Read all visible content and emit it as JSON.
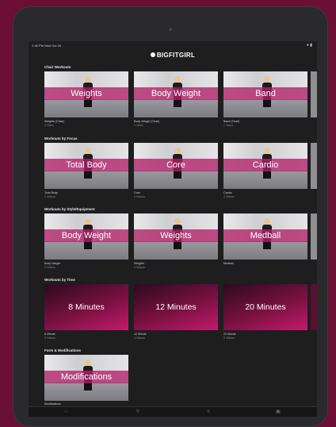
{
  "status_bar": {
    "time": "2:38 PM  Wed Oct 26",
    "indicators": "● ▮"
  },
  "app": {
    "logo": "BIGFITGIRL"
  },
  "sections": [
    {
      "title": "Chair Workouts",
      "cards": [
        {
          "label": "Weights",
          "caption": "Weights (Chair)",
          "sub": "1 Video"
        },
        {
          "label": "Body Weight",
          "caption": "Body Weight (Chair)",
          "sub": "1 Video"
        },
        {
          "label": "Band",
          "caption": "Band (Chair)",
          "sub": "1 Video"
        }
      ]
    },
    {
      "title": "Workouts by Focus",
      "cards": [
        {
          "label": "Total Body",
          "caption": "Total Body",
          "sub": "2 Videos"
        },
        {
          "label": "Core",
          "caption": "Core",
          "sub": "2 Videos"
        },
        {
          "label": "Cardio",
          "caption": "Cardio",
          "sub": "2 Videos"
        }
      ]
    },
    {
      "title": "Workouts by Style/Equipment",
      "cards": [
        {
          "label": "Body Weight",
          "caption": "Body Weight",
          "sub": "2 Videos"
        },
        {
          "label": "Weights",
          "caption": "Weights",
          "sub": "2 Videos"
        },
        {
          "label": "Medball",
          "caption": "Medball",
          "sub": ""
        }
      ]
    },
    {
      "title": "Workouts by Time",
      "cards": [
        {
          "label": "8 Minutes",
          "caption": "8 Minute",
          "sub": "3 Videos"
        },
        {
          "label": "12 Minutes",
          "caption": "12 Minute",
          "sub": "4 Videos"
        },
        {
          "label": "20 Minutes",
          "caption": "20 Minute",
          "sub": "3 Videos"
        }
      ]
    },
    {
      "title": "Form & Modifications",
      "cards": [
        {
          "label": "Modifications",
          "caption": "Modifications",
          "sub": ""
        }
      ]
    }
  ],
  "tabbar": {
    "items": [
      {
        "icon": "home-icon",
        "glyph": "⌂"
      },
      {
        "icon": "search-icon",
        "glyph": "⚲"
      },
      {
        "icon": "library-icon",
        "glyph": "≡"
      },
      {
        "icon": "profile-icon",
        "glyph": "▣"
      }
    ]
  },
  "colors": {
    "brand": "#b12068",
    "background": "#6b0f35",
    "screen": "#1e1e1f"
  }
}
